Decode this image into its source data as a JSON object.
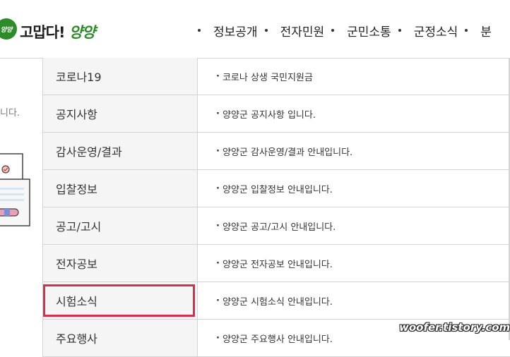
{
  "logo": {
    "badge": "양양",
    "text_main": "고맙다!",
    "text_accent": "양양"
  },
  "gnb": {
    "items": [
      {
        "label": "정보공개"
      },
      {
        "label": "전자민원"
      },
      {
        "label": "군민소통"
      },
      {
        "label": "군정소식"
      },
      {
        "label": "분"
      }
    ]
  },
  "sidebar": {
    "partial_text": "니다."
  },
  "table": {
    "rows": [
      {
        "name": "코로나19",
        "desc": "코로나 상생 국민지원금"
      },
      {
        "name": "공지사항",
        "desc": "양양군 공지사항 입니다."
      },
      {
        "name": "감사운영/결과",
        "desc": "양양군 감사운영/결과 안내입니다."
      },
      {
        "name": "입찰정보",
        "desc": "양양군 입찰정보 안내입니다."
      },
      {
        "name": "공고/고시",
        "desc": "양양군 공고/고시 안내입니다."
      },
      {
        "name": "전자공보",
        "desc": "양양군 전자공보 안내입니다."
      },
      {
        "name": "시험소식",
        "desc": "양양군 시험소식 안내입니다."
      },
      {
        "name": "주요행사",
        "desc": "양양군 주요행사 안내입니다."
      }
    ],
    "highlight_row_index": 6
  },
  "watermark": "woofer.tistory.com",
  "colors": {
    "brand_green": "#2f8a2a",
    "highlight_red": "#d6304a",
    "row_label_bg": "#f5f5f5"
  }
}
